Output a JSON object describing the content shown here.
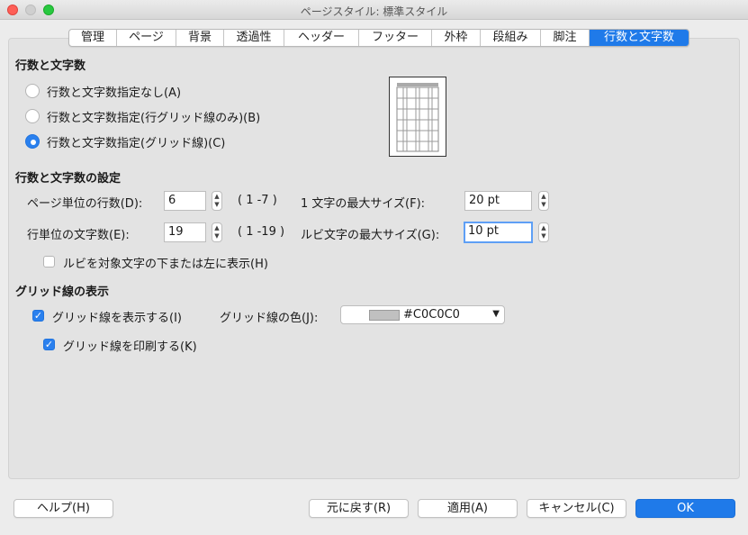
{
  "window": {
    "title": "ページスタイル: 標準スタイル"
  },
  "tabs": [
    {
      "label": "管理"
    },
    {
      "label": "ページ"
    },
    {
      "label": "背景"
    },
    {
      "label": "透過性"
    },
    {
      "label": "ヘッダー"
    },
    {
      "label": "フッター"
    },
    {
      "label": "外枠"
    },
    {
      "label": "段組み"
    },
    {
      "label": "脚注"
    },
    {
      "label": "行数と文字数",
      "selected": true
    }
  ],
  "grid_mode": {
    "title": "行数と文字数",
    "options": [
      {
        "label": "行数と文字数指定なし(A)",
        "checked": false
      },
      {
        "label": "行数と文字数指定(行グリッド線のみ)(B)",
        "checked": false
      },
      {
        "label": "行数と文字数指定(グリッド線)(C)",
        "checked": true
      }
    ]
  },
  "layout_settings": {
    "title": "行数と文字数の設定",
    "lines_per_page": {
      "label": "ページ単位の行数(D):",
      "value": "6",
      "range": "( 1 -7 )"
    },
    "chars_per_line": {
      "label": "行単位の文字数(E):",
      "value": "19",
      "range": "( 1 -19 )"
    },
    "max_char_size": {
      "label": "1 文字の最大サイズ(F):",
      "value": "20 pt"
    },
    "max_ruby_size": {
      "label": "ルビ文字の最大サイズ(G):",
      "value": "10 pt"
    },
    "ruby_below": {
      "label": "ルビを対象文字の下または左に表示(H)",
      "checked": false
    }
  },
  "grid_display": {
    "title": "グリッド線の表示",
    "show_grid": {
      "label": "グリッド線を表示する(I)",
      "checked": true
    },
    "grid_color": {
      "label": "グリッド線の色(J):",
      "value": "#C0C0C0",
      "swatch": "#c0c0c0"
    },
    "print_grid": {
      "label": "グリッド線を印刷する(K)",
      "checked": true
    }
  },
  "buttons": {
    "help": "ヘルプ(H)",
    "reset": "元に戻す(R)",
    "apply": "適用(A)",
    "cancel": "キャンセル(C)",
    "ok": "OK"
  },
  "colors": {
    "accent": "#1f7ae9",
    "grid": "#c0c0c0"
  }
}
